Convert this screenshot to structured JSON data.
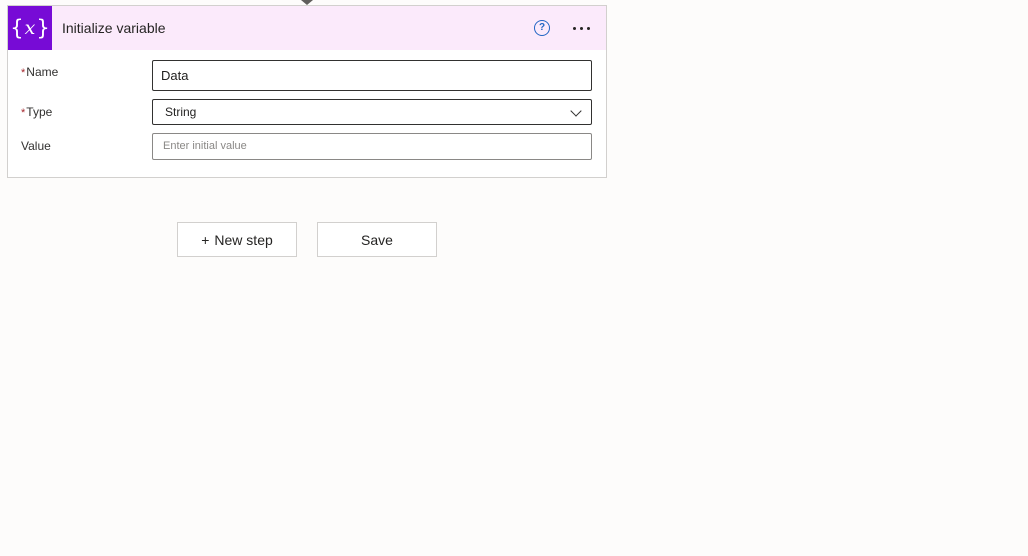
{
  "action_card": {
    "title": "Initialize variable",
    "icon": "variable-icon",
    "icon_glyph": "x",
    "accent_color": "#770bd6",
    "header_bg": "#fbeafb",
    "help_icon_glyph": "?",
    "fields": {
      "name": {
        "required": "*",
        "label": "Name",
        "value": "Data"
      },
      "type": {
        "required": "*",
        "label": "Type",
        "value": "String"
      },
      "value": {
        "label": "Value",
        "placeholder": "Enter initial value"
      }
    }
  },
  "actions": {
    "new_step_plus": "+",
    "new_step_label": "New step",
    "save_label": "Save"
  }
}
